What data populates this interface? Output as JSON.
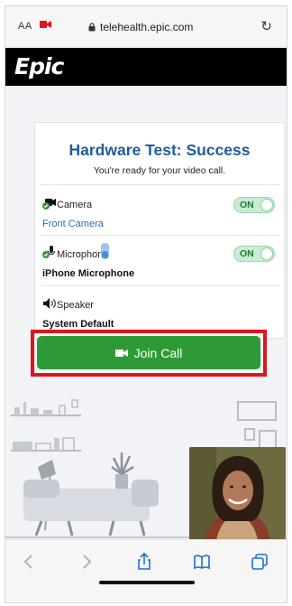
{
  "browser": {
    "text_size_label": "AA",
    "url": "telehealth.epic.com"
  },
  "header": {
    "logo_text": "Epic"
  },
  "hardware_test": {
    "title": "Hardware Test: Success",
    "subtitle": "You're ready for your video call.",
    "devices": [
      {
        "name": "Camera",
        "device": "Front Camera",
        "toggle": "ON"
      },
      {
        "name": "Microphone",
        "device": "iPhone Microphone",
        "toggle": "ON"
      },
      {
        "name": "Speaker",
        "device": "System Default"
      }
    ]
  },
  "join_button": {
    "label": "Join Call"
  },
  "colors": {
    "title_blue": "#1f5c9b",
    "join_green": "#2e9a37",
    "highlight_red": "#e0141e",
    "toggle_green": "#c9ecd2"
  },
  "toolbar": {
    "icons": [
      "back-icon",
      "forward-icon",
      "share-icon",
      "bookmarks-icon",
      "tabs-icon"
    ]
  }
}
